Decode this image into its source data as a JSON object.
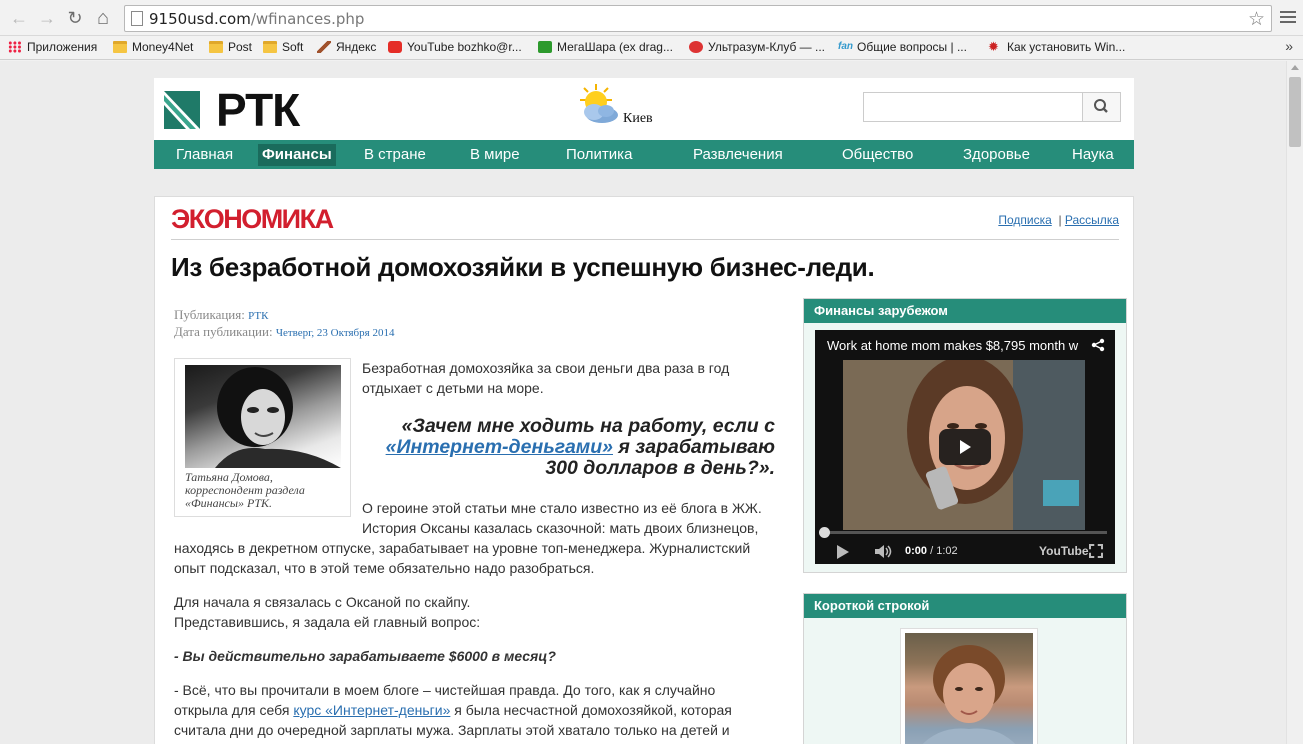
{
  "browser": {
    "url_host": "9150usd.com",
    "url_path": "/wfinances.php",
    "bookmarks": [
      {
        "label": "Приложения",
        "icon": "apps-icon"
      },
      {
        "label": "Money4Net",
        "icon": "folder-icon"
      },
      {
        "label": "Post",
        "icon": "folder-icon"
      },
      {
        "label": "Soft",
        "icon": "folder-icon"
      },
      {
        "label": "Яндекс",
        "icon": "pen-icon"
      },
      {
        "label": "YouTube bozhko@r...",
        "icon": "youtube-icon"
      },
      {
        "label": "МегаШара (ex drag...",
        "icon": "megashara-icon"
      },
      {
        "label": "Ультразум-Клуб — ...",
        "icon": "ultrazoom-icon"
      },
      {
        "label": "Общие вопросы | ...",
        "icon": "fan-icon"
      },
      {
        "label": "Как установить Win...",
        "icon": "gear-icon"
      }
    ],
    "more": "»"
  },
  "site": {
    "logo_text": "РТК",
    "weather_city": "Киев",
    "search_placeholder": ""
  },
  "nav": [
    {
      "label": "Главная",
      "active": false
    },
    {
      "label": "Финансы",
      "active": true
    },
    {
      "label": "В стране",
      "active": false
    },
    {
      "label": "В мире",
      "active": false
    },
    {
      "label": "Политика",
      "active": false
    },
    {
      "label": "Развлечения",
      "active": false
    },
    {
      "label": "Общество",
      "active": false
    },
    {
      "label": "Здоровье",
      "active": false
    },
    {
      "label": "Наука",
      "active": false
    }
  ],
  "section": {
    "title": "ЭКОНОМИКА",
    "link_subscribe": "Подписка",
    "separator": "|",
    "link_mailing": "Рассылка"
  },
  "article": {
    "headline": "Из безработной домохозяйки в успешную бизнес-леди.",
    "meta_pub_label": "Публикация:",
    "meta_pub_value": "РТК",
    "meta_date_label": "Дата публикации:",
    "meta_date_value": "Четверг, 23 Октября 2014",
    "photo_caption_1": "Татьяна Домова,",
    "photo_caption_2": "корреспондент раздела",
    "photo_caption_3": "«Финансы» РТК.",
    "intro_1": "Безработная домохозяйка за свои деньги два раза в год",
    "intro_2": "отдыхает с детьми на море.",
    "quote_1": "«Зачем мне ходить на работу, если с",
    "quote_link": "«Интернет-деньгами»",
    "quote_2": " я зарабатываю",
    "quote_3": "300 долларов в день?».",
    "p1_1": "О героине этой статьи мне стало известно из её блога в ЖЖ.",
    "p1_2": "История Оксаны казалась сказочной: мать двоих близнецов,",
    "p1_3": "находясь в декретном отпуске, зарабатывает на уровне топ-менеджера. Журналистский",
    "p1_4": "опыт подсказал, что в этой теме обязательно надо разобраться.",
    "p2_1": "Для начала я связалась с Оксаной по скайпу.",
    "p2_2": "Представившись, я задала ей главный вопрос:",
    "question": "- Вы действительно зарабатываете $6000 в месяц?",
    "p3_1": "- Всё, что вы прочитали в моем блоге – чистейшая правда. До того, как я случайно",
    "p3_2a": "открыла для себя ",
    "p3_link": "курс «Интернет-деньги»",
    "p3_2b": " я была несчастной домохозяйкой, которая",
    "p3_3": "считала дни до очередной зарплаты мужа. Зарплаты этой хватало только на детей и"
  },
  "sidebar": {
    "widget1_title": "Финансы зарубежом",
    "video_title": "Work at home mom makes $8,795 month w",
    "video_time_current": "0:00",
    "video_time_total": " / 1:02",
    "video_brand": "YouTube",
    "video_progress": 0,
    "widget2_title": "Короткой строкой"
  },
  "colors": {
    "brand_green": "#268d7a",
    "section_red": "#d21f2e",
    "link_blue": "#2a6fb0"
  }
}
